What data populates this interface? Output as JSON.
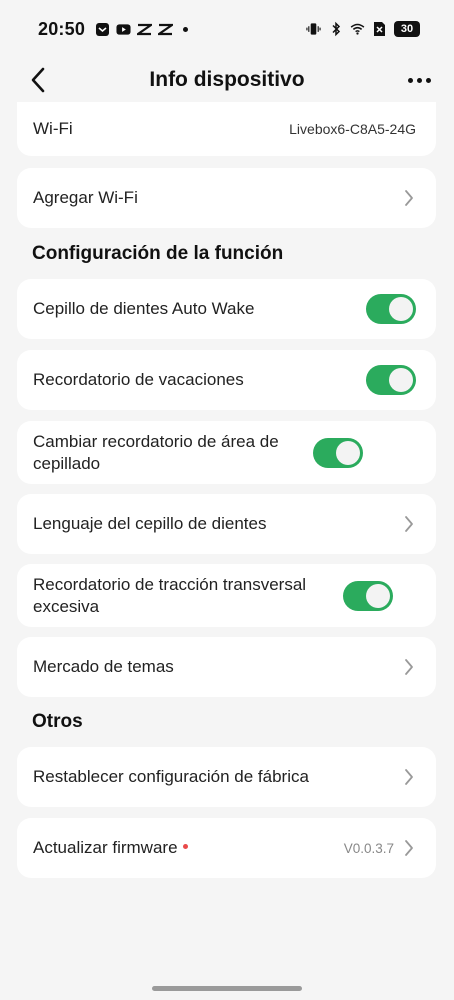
{
  "status_bar": {
    "time": "20:50",
    "battery": "30",
    "left_icons": [
      "pocket-app-icon",
      "youtube-icon",
      "capcut-icon",
      "capcut-icon",
      "notification-dot-icon"
    ],
    "right_icons": [
      "vibrate-icon",
      "bluetooth-icon",
      "wifi-icon",
      "sim-x-icon",
      "battery-icon"
    ]
  },
  "header": {
    "title": "Info dispositivo",
    "back_icon": "arrow-left-icon",
    "more_icon": "more-horizontal-icon"
  },
  "rows": {
    "wifi": {
      "label": "Wi-Fi",
      "value": "Livebox6-C8A5-24G"
    },
    "add_wifi": {
      "label": "Agregar Wi-Fi"
    }
  },
  "sections": {
    "function_config": "Configuración de la función",
    "others": "Otros"
  },
  "function_items": [
    {
      "label": "Cepillo de dientes Auto Wake",
      "control": "toggle",
      "on": true
    },
    {
      "label": "Recordatorio de vacaciones",
      "control": "toggle",
      "on": true
    },
    {
      "label": "Cambiar recordatorio de área de cepillado",
      "control": "toggle",
      "on": true
    },
    {
      "label": "Lenguaje del cepillo de dientes",
      "control": "chevron"
    },
    {
      "label": "Recordatorio de tracción transversal excesiva",
      "control": "toggle",
      "on": true
    },
    {
      "label": "Mercado de temas",
      "control": "chevron"
    }
  ],
  "other_items": [
    {
      "label": "Restablecer configuración de fábrica",
      "control": "chevron"
    },
    {
      "label": "Actualizar firmware",
      "control": "chevron",
      "version": "V0.0.3.7",
      "badge": true
    }
  ],
  "colors": {
    "toggle_on": "#2bab5d",
    "background": "#f5f5f5",
    "card": "#ffffff",
    "badge": "#e94a4a"
  }
}
